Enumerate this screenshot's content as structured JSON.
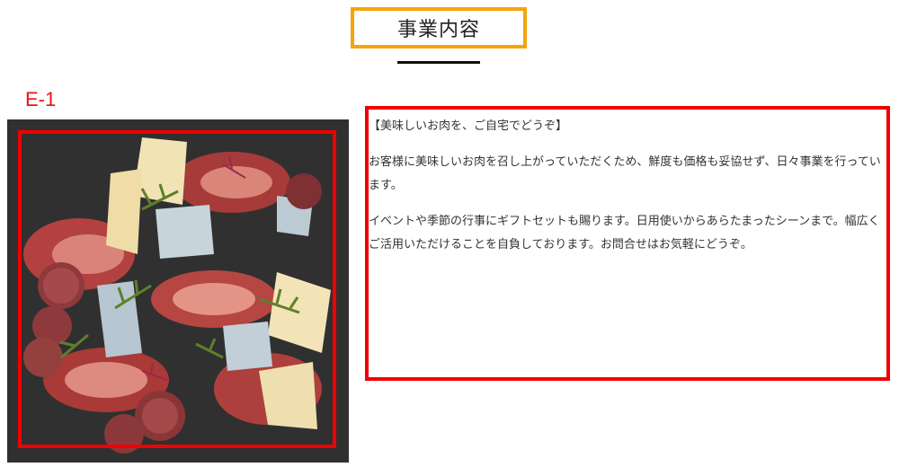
{
  "header": {
    "title": "事業内容"
  },
  "section": {
    "id_label": "E-1",
    "image": {
      "subject": "cured-meat-and-cheese-platter"
    },
    "text": {
      "heading": "【美味しいお肉を、ご自宅でどうぞ】",
      "paragraph_1": "お客様に美味しいお肉を召し上がっていただくため、鮮度も価格も妥協せず、日々事業を行っています。",
      "paragraph_2": "イベントや季節の行事にギフトセットも賜ります。日用使いからあらたまったシーンまで。幅広くご活用いただけることを自負しております。お問合せはお気軽にどうぞ。"
    }
  },
  "colors": {
    "title_border": "#f5a40a",
    "annotation_red": "#f00000",
    "underline": "#111111"
  }
}
